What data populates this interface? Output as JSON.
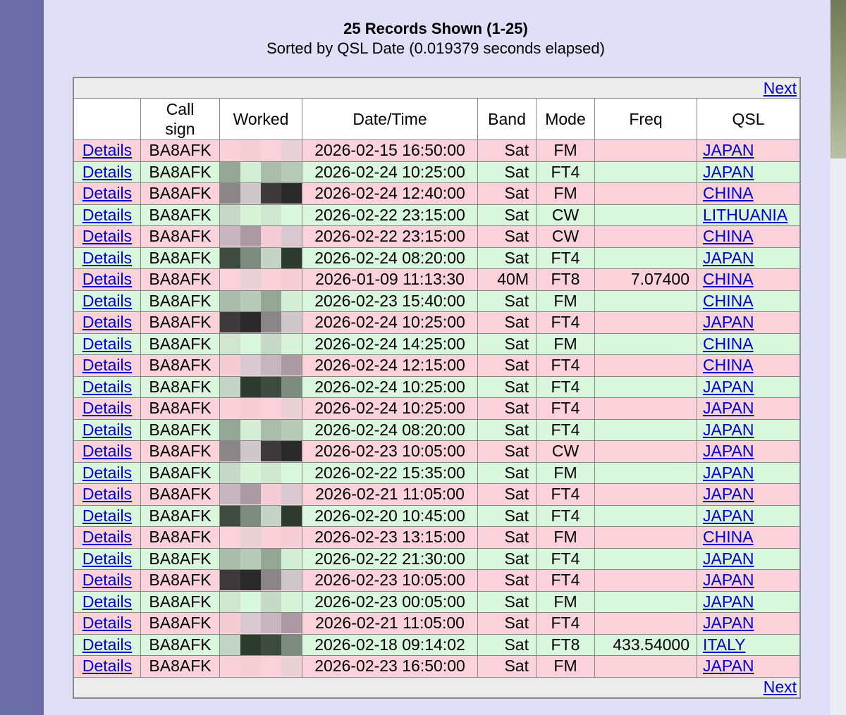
{
  "header": {
    "title": "25 Records Shown (1-25)",
    "subtitle": "Sorted by QSL Date (0.019379 seconds elapsed)"
  },
  "nav": {
    "next_label": "Next"
  },
  "columns": [
    "",
    "Call sign",
    "Worked",
    "Date/Time",
    "Band",
    "Mode",
    "Freq",
    "QSL"
  ],
  "details_label": "Details",
  "rows": [
    {
      "call": "BA8AFK",
      "date": "2026-02-15 16:50:00",
      "band": "Sat",
      "mode": "FM",
      "freq": "",
      "qsl": "JAPAN",
      "color": "pink"
    },
    {
      "call": "BA8AFK",
      "date": "2026-02-24 10:25:00",
      "band": "Sat",
      "mode": "FT4",
      "freq": "",
      "qsl": "JAPAN",
      "color": "green"
    },
    {
      "call": "BA8AFK",
      "date": "2026-02-24 12:40:00",
      "band": "Sat",
      "mode": "FM",
      "freq": "",
      "qsl": "CHINA",
      "color": "pink"
    },
    {
      "call": "BA8AFK",
      "date": "2026-02-22 23:15:00",
      "band": "Sat",
      "mode": "CW",
      "freq": "",
      "qsl": "LITHUANIA",
      "color": "green"
    },
    {
      "call": "BA8AFK",
      "date": "2026-02-22 23:15:00",
      "band": "Sat",
      "mode": "CW",
      "freq": "",
      "qsl": "CHINA",
      "color": "pink"
    },
    {
      "call": "BA8AFK",
      "date": "2026-02-24 08:20:00",
      "band": "Sat",
      "mode": "FT4",
      "freq": "",
      "qsl": "JAPAN",
      "color": "green"
    },
    {
      "call": "BA8AFK",
      "date": "2026-01-09 11:13:30",
      "band": "40M",
      "mode": "FT8",
      "freq": "7.07400",
      "qsl": "CHINA",
      "color": "pink"
    },
    {
      "call": "BA8AFK",
      "date": "2026-02-23 15:40:00",
      "band": "Sat",
      "mode": "FM",
      "freq": "",
      "qsl": "CHINA",
      "color": "green"
    },
    {
      "call": "BA8AFK",
      "date": "2026-02-24 10:25:00",
      "band": "Sat",
      "mode": "FT4",
      "freq": "",
      "qsl": "JAPAN",
      "color": "pink"
    },
    {
      "call": "BA8AFK",
      "date": "2026-02-24 14:25:00",
      "band": "Sat",
      "mode": "FM",
      "freq": "",
      "qsl": "CHINA",
      "color": "green"
    },
    {
      "call": "BA8AFK",
      "date": "2026-02-24 12:15:00",
      "band": "Sat",
      "mode": "FT4",
      "freq": "",
      "qsl": "CHINA",
      "color": "pink"
    },
    {
      "call": "BA8AFK",
      "date": "2026-02-24 10:25:00",
      "band": "Sat",
      "mode": "FT4",
      "freq": "",
      "qsl": "JAPAN",
      "color": "green"
    },
    {
      "call": "BA8AFK",
      "date": "2026-02-24 10:25:00",
      "band": "Sat",
      "mode": "FT4",
      "freq": "",
      "qsl": "JAPAN",
      "color": "pink"
    },
    {
      "call": "BA8AFK",
      "date": "2026-02-24 08:20:00",
      "band": "Sat",
      "mode": "FT4",
      "freq": "",
      "qsl": "JAPAN",
      "color": "green"
    },
    {
      "call": "BA8AFK",
      "date": "2026-02-23 10:05:00",
      "band": "Sat",
      "mode": "CW",
      "freq": "",
      "qsl": "JAPAN",
      "color": "pink"
    },
    {
      "call": "BA8AFK",
      "date": "2026-02-22 15:35:00",
      "band": "Sat",
      "mode": "FM",
      "freq": "",
      "qsl": "JAPAN",
      "color": "green"
    },
    {
      "call": "BA8AFK",
      "date": "2026-02-21 11:05:00",
      "band": "Sat",
      "mode": "FT4",
      "freq": "",
      "qsl": "JAPAN",
      "color": "pink"
    },
    {
      "call": "BA8AFK",
      "date": "2026-02-20 10:45:00",
      "band": "Sat",
      "mode": "FT4",
      "freq": "",
      "qsl": "JAPAN",
      "color": "green"
    },
    {
      "call": "BA8AFK",
      "date": "2026-02-23 13:15:00",
      "band": "Sat",
      "mode": "FM",
      "freq": "",
      "qsl": "CHINA",
      "color": "pink"
    },
    {
      "call": "BA8AFK",
      "date": "2026-02-22 21:30:00",
      "band": "Sat",
      "mode": "FT4",
      "freq": "",
      "qsl": "JAPAN",
      "color": "green"
    },
    {
      "call": "BA8AFK",
      "date": "2026-02-23 10:05:00",
      "band": "Sat",
      "mode": "FT4",
      "freq": "",
      "qsl": "JAPAN",
      "color": "pink"
    },
    {
      "call": "BA8AFK",
      "date": "2026-02-23 00:05:00",
      "band": "Sat",
      "mode": "FM",
      "freq": "",
      "qsl": "JAPAN",
      "color": "green"
    },
    {
      "call": "BA8AFK",
      "date": "2026-02-21 11:05:00",
      "band": "Sat",
      "mode": "FT4",
      "freq": "",
      "qsl": "JAPAN",
      "color": "pink"
    },
    {
      "call": "BA8AFK",
      "date": "2026-02-18 09:14:02",
      "band": "Sat",
      "mode": "FT8",
      "freq": "433.54000",
      "qsl": "ITALY",
      "color": "green"
    },
    {
      "call": "BA8AFK",
      "date": "2026-02-23 16:50:00",
      "band": "Sat",
      "mode": "FM",
      "freq": "",
      "qsl": "JAPAN",
      "color": "pink"
    }
  ]
}
